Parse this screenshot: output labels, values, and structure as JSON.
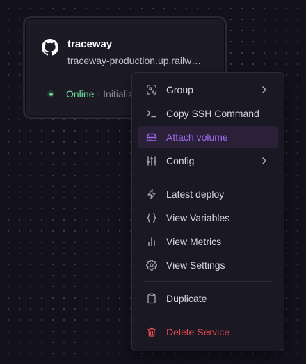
{
  "card": {
    "title": "traceway",
    "url": "traceway-production.up.railway.app",
    "status": "Online",
    "status_separator": "·",
    "status_detail": "Initializing",
    "icon": "github-icon",
    "status_color": "#6ddb9a"
  },
  "menu": {
    "items": [
      {
        "label": "Group",
        "icon": "group-icon",
        "submenu": true
      },
      {
        "label": "Copy SSH Command",
        "icon": "terminal-icon"
      },
      {
        "label": "Attach volume",
        "icon": "hard-drive-icon",
        "highlighted": true
      },
      {
        "label": "Config",
        "icon": "sliders-icon",
        "submenu": true
      },
      {
        "label": "Latest deploy",
        "icon": "lightning-icon"
      },
      {
        "label": "View Variables",
        "icon": "braces-icon"
      },
      {
        "label": "View Metrics",
        "icon": "bar-chart-icon"
      },
      {
        "label": "View Settings",
        "icon": "gear-icon"
      },
      {
        "label": "Duplicate",
        "icon": "clipboard-icon"
      },
      {
        "label": "Delete Service",
        "icon": "trash-icon",
        "danger": true
      }
    ]
  },
  "colors": {
    "background": "#13111c",
    "accent": "#a06bf0",
    "danger": "#e5484d",
    "online": "#6ddb9a"
  }
}
